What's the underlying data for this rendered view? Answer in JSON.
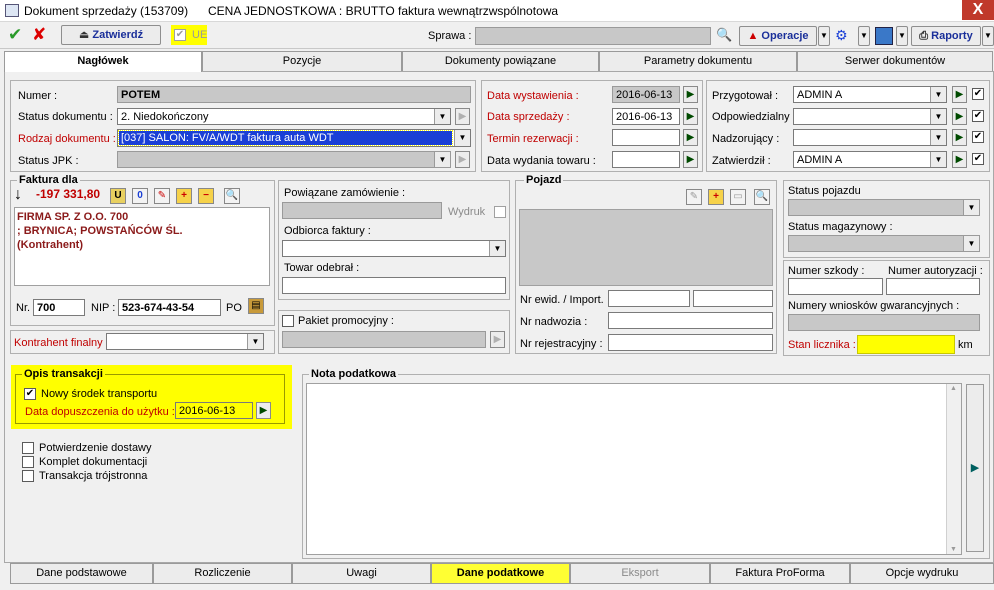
{
  "titlebar": {
    "title": "Dokument sprzedaży (153709)",
    "price_mode": "CENA JEDNOSTKOWA : BRUTTO",
    "kind": "faktura wewnątrzwspólnotowa",
    "close": "X"
  },
  "toolbar": {
    "approve": "Zatwierdź",
    "ue_label": "UE",
    "sprawa_label": "Sprawa :",
    "sprawa_value": "",
    "operations": "Operacje",
    "reports": "Raporty"
  },
  "tabs": [
    "Nagłówek",
    "Pozycje",
    "Dokumenty powiązane",
    "Parametry dokumentu",
    "Serwer dokumentów"
  ],
  "header": {
    "numer_label": "Numer :",
    "numer_value": "POTEM",
    "status_label": "Status dokumentu :",
    "status_value": "2. Niedokończony",
    "rodzaj_label": "Rodzaj dokumentu :",
    "rodzaj_value": "[037] SALON: FV/A/WDT faktura auta WDT",
    "jpk_label": "Status JPK :",
    "jpk_value": ""
  },
  "dates": {
    "wyst_label": "Data wystawienia :",
    "wyst_value": "2016-06-13",
    "sprz_label": "Data sprzedaży :",
    "sprz_value": "2016-06-13",
    "rez_label": "Termin rezerwacji :",
    "rez_value": "",
    "wyd_label": "Data wydania towaru :",
    "wyd_value": ""
  },
  "people": {
    "przyg_label": "Przygotował :",
    "przyg_value": "ADMIN A",
    "odp_label": "Odpowiedzialny :",
    "odp_value": "",
    "nadz_label": "Nadzorujący :",
    "nadz_value": "",
    "zatw_label": "Zatwierdził :",
    "zatw_value": "ADMIN A"
  },
  "faktura": {
    "title": "Faktura dla",
    "amount": "-197 331,80",
    "line1": "FIRMA SP. Z O.O. 700",
    "line2": "; BRYNICA;  POWSTAŃCÓW ŚL.",
    "line3": "(Kontrahent)",
    "nr_label": "Nr.",
    "nr_value": "700",
    "nip_label": "NIP :",
    "nip_value": "523-674-43-54",
    "po_label": "PO",
    "kf_label": "Kontrahent finalny :",
    "kf_value": ""
  },
  "middle": {
    "zam_label": "Powiązane zamówienie :",
    "wydruk_label": "Wydruk",
    "odbiorca_label": "Odbiorca faktury :",
    "towar_label": "Towar odebrał :",
    "pakiet_label": "Pakiet promocyjny :"
  },
  "pojazd": {
    "title": "Pojazd",
    "ewid_label": "Nr ewid. / Import.",
    "nadwozia_label": "Nr nadwozia :",
    "rej_label": "Nr rejestracyjny :"
  },
  "status": {
    "pojazdu_label": "Status pojazdu",
    "mag_label": "Status magazynowy :",
    "szkody_label": "Numer szkody :",
    "autor_label": "Numer autoryzacji :",
    "wnioski_label": "Numery wniosków gwarancyjnych :",
    "licznik_label": "Stan licznika :",
    "km": "km"
  },
  "opis": {
    "title": "Opis transakcji",
    "nowy": "Nowy środek transportu",
    "dop_label": "Data dopuszczenia do użytku :",
    "dop_value": "2016-06-13",
    "c1": "Potwierdzenie dostawy",
    "c2": "Komplet dokumentacji",
    "c3": "Transakcja trójstronna"
  },
  "nota": {
    "title": "Nota podatkowa"
  },
  "bottom_tabs": [
    "Dane podstawowe",
    "Rozliczenie",
    "Uwagi",
    "Dane podatkowe",
    "Eksport",
    "Faktura ProForma",
    "Opcje wydruku"
  ],
  "colors": {
    "accent_yellow": "#ffff00",
    "label_red": "#c00000",
    "selected_blue": "#1a3fd6"
  }
}
